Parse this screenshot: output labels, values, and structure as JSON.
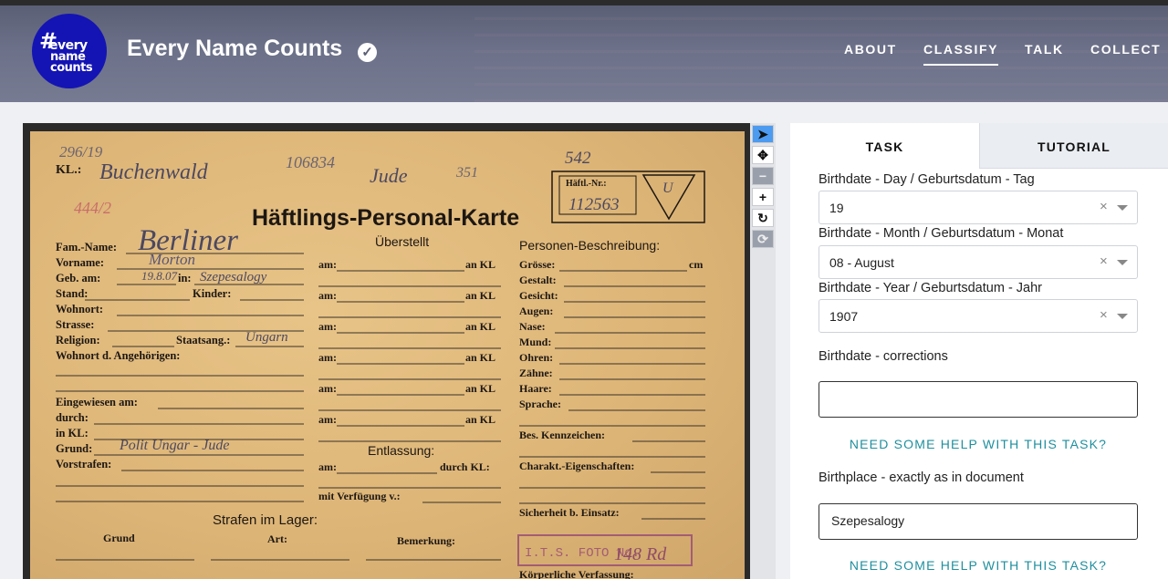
{
  "site": {
    "title": "Every Name Counts",
    "logo_lines": [
      "#",
      "every",
      "name",
      "counts"
    ]
  },
  "nav": [
    "ABOUT",
    "CLASSIFY",
    "TALK",
    "COLLECT"
  ],
  "card": {
    "top_numbers": "296/19",
    "kl_label": "KL.:",
    "kl_value": "Buchenwald",
    "number_1": "106834",
    "jude": "Jude",
    "jude_num": "351",
    "num_542": "542",
    "haeftl_nr_label": "Häftl.-Nr.:",
    "haeftl_nr": "112563",
    "triangle_mark": "U",
    "title": "Häftlings-Personal-Karte",
    "red_mark": "444/2",
    "fam_name_label": "Fam.-Name:",
    "fam_name": "Berliner",
    "vorname_label": "Vorname:",
    "vorname": "Morton",
    "geb_label": "Geb. am:",
    "geb_value": "19.8.07",
    "in_label": "in:",
    "in_value": "Szepesalogy",
    "stand_label": "Stand:",
    "kinder_label": "Kinder:",
    "wohnort_label": "Wohnort:",
    "strasse_label": "Strasse:",
    "religion_label": "Religion:",
    "staatsang_label": "Staatsang.:",
    "staatsang_value": "Ungarn",
    "wohnort_ang_label": "Wohnort d. Angehörigen:",
    "eingewiesen_label": "Eingewiesen am:",
    "durch_label": "durch:",
    "in_kl_label": "in KL:",
    "grund_label": "Grund:",
    "grund_value": "Polit Ungar - Jude",
    "vorstrafen_label": "Vorstrafen:",
    "ueberstellt": "Überstellt",
    "am": "am:",
    "an_kl": "an KL",
    "entlassung": "Entlassung:",
    "durch_kl": "durch KL:",
    "mit_verfuegung": "mit Verfügung v.:",
    "personen": "Personen-Beschreibung:",
    "grosse": "Grösse:",
    "cm": "cm",
    "gestalt": "Gestalt:",
    "gesicht": "Gesicht:",
    "augen": "Augen:",
    "nase": "Nase:",
    "mund": "Mund:",
    "ohren": "Ohren:",
    "zaehne": "Zähne:",
    "haare": "Haare:",
    "sprache": "Sprache:",
    "kennzeichen": "Bes. Kennzeichen:",
    "charakt": "Charakt.-Eigenschaften:",
    "sicherheit": "Sicherheit b. Einsatz:",
    "koerper": "Körperliche Verfassung:",
    "strafen": "Strafen im Lager:",
    "grund_col": "Grund",
    "art_col": "Art:",
    "bemerkung_col": "Bemerkung:",
    "stamp": "I.T.S. FOTO No.",
    "stamp_num": "148 Rd"
  },
  "toolbar": [
    "pointer-icon",
    "move-icon",
    "zoom-out-icon",
    "zoom-in-icon",
    "rotate-icon",
    "reset-icon"
  ],
  "panel": {
    "tab_task": "TASK",
    "tab_tutorial": "TUTORIAL",
    "day_label": "Birthdate - Day / Geburtsdatum - Tag",
    "day_value": "19",
    "month_label": "Birthdate - Month / Geburtsdatum - Monat",
    "month_value": "08 - August",
    "year_label": "Birthdate - Year / Geburtsdatum - Jahr",
    "year_value": "1907",
    "corrections_label": "Birthdate - corrections",
    "corrections_value": "",
    "help_1": "NEED SOME HELP WITH THIS TASK?",
    "birthplace_label": "Birthplace - exactly as in document",
    "birthplace_value": "Szepesalogy",
    "help_2": "NEED SOME HELP WITH THIS TASK?",
    "clear_glyph": "×"
  }
}
